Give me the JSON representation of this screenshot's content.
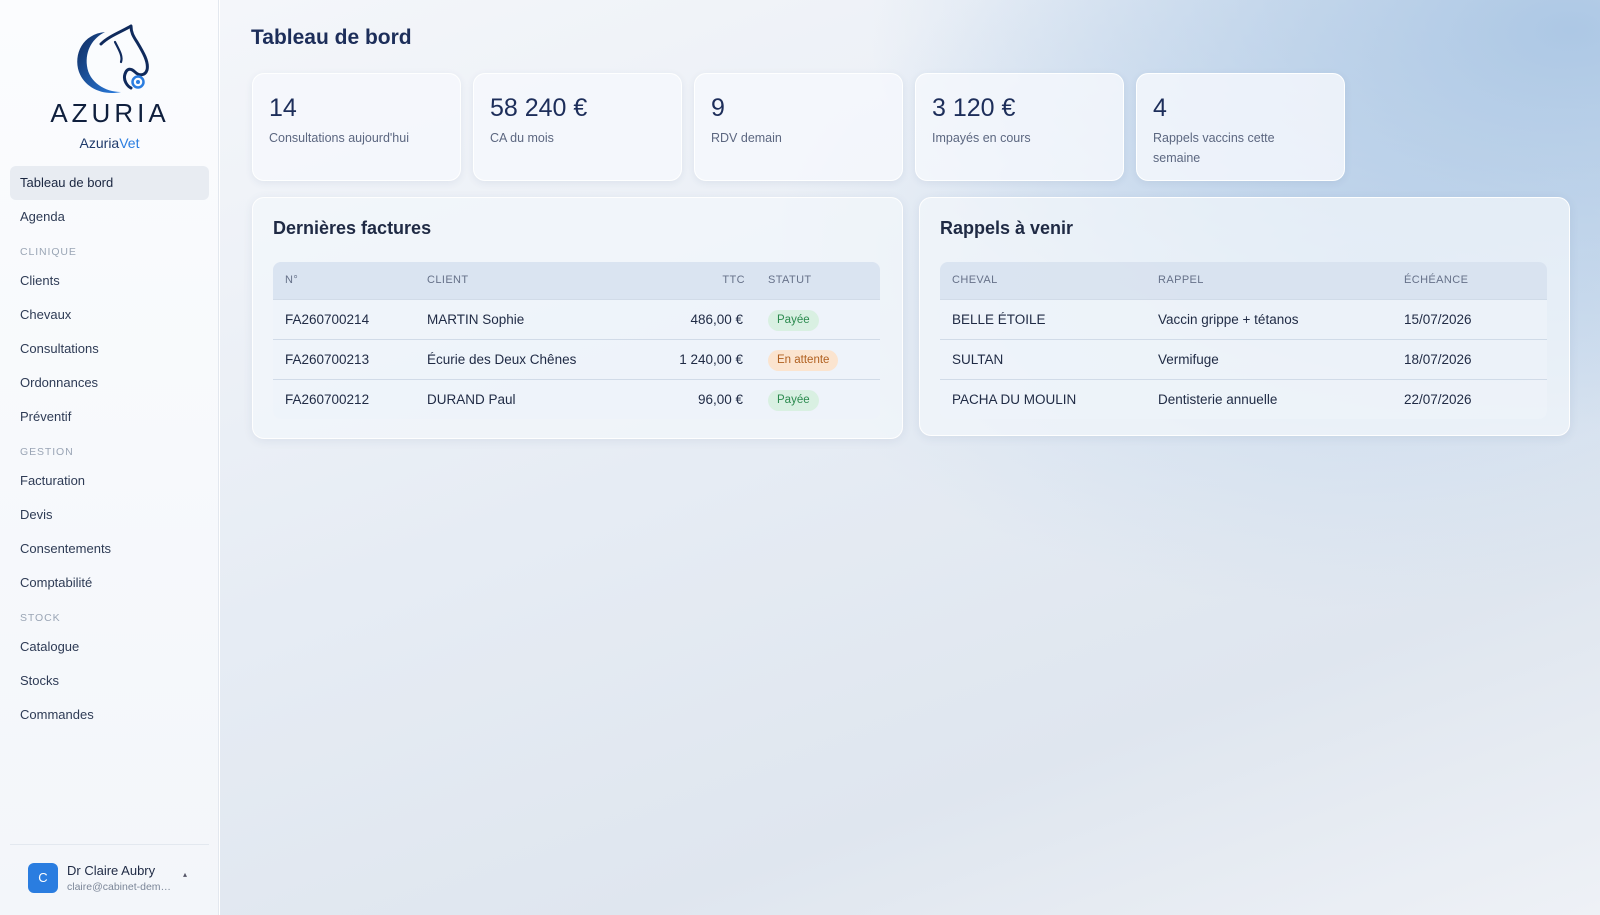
{
  "brand": {
    "logo_text": "AZURIA",
    "name_main": "Azuria",
    "name_accent": "Vet"
  },
  "nav": {
    "dashboard": "Tableau de bord",
    "agenda": "Agenda",
    "section_clinique": "CLINIQUE",
    "clients": "Clients",
    "chevaux": "Chevaux",
    "consultations": "Consultations",
    "ordonnances": "Ordonnances",
    "preventif": "Préventif",
    "section_gestion": "GESTION",
    "facturation": "Facturation",
    "devis": "Devis",
    "consentements": "Consentements",
    "comptabilite": "Comptabilité",
    "section_stock": "STOCK",
    "catalogue": "Catalogue",
    "stocks": "Stocks",
    "commandes": "Commandes"
  },
  "user": {
    "initial": "C",
    "name": "Dr Claire Aubry",
    "email": "claire@cabinet-demo.fr",
    "caret": "▴"
  },
  "page": {
    "title": "Tableau de bord"
  },
  "kpis": [
    {
      "value": "14",
      "label": "Consultations aujourd'hui"
    },
    {
      "value": "58 240 €",
      "label": "CA du mois"
    },
    {
      "value": "9",
      "label": "RDV demain"
    },
    {
      "value": "3 120 €",
      "label": "Impayés en cours"
    },
    {
      "value": "4",
      "label": "Rappels vaccins cette semaine"
    }
  ],
  "invoices": {
    "title": "Dernières factures",
    "headers": {
      "num": "N°",
      "client": "CLIENT",
      "ttc": "TTC",
      "status": "STATUT"
    },
    "rows": [
      {
        "num": "FA260700214",
        "client": "MARTIN Sophie",
        "ttc": "486,00 €",
        "status": "Payée",
        "status_type": "paid"
      },
      {
        "num": "FA260700213",
        "client": "Écurie des Deux Chênes",
        "ttc": "1 240,00 €",
        "status": "En attente",
        "status_type": "pending"
      },
      {
        "num": "FA260700212",
        "client": "DURAND Paul",
        "ttc": "96,00 €",
        "status": "Payée",
        "status_type": "paid"
      }
    ]
  },
  "reminders": {
    "title": "Rappels à venir",
    "headers": {
      "horse": "CHEVAL",
      "reminder": "RAPPEL",
      "due": "ÉCHÉANCE"
    },
    "rows": [
      {
        "horse": "BELLE ÉTOILE",
        "reminder": "Vaccin grippe + tétanos",
        "due": "15/07/2026"
      },
      {
        "horse": "SULTAN",
        "reminder": "Vermifuge",
        "due": "18/07/2026"
      },
      {
        "horse": "PACHA DU MOULIN",
        "reminder": "Dentisterie annuelle",
        "due": "22/07/2026"
      }
    ]
  },
  "colors": {
    "accent": "#2a7de0",
    "navy": "#1d2e5a",
    "paid": "#2b8a4e",
    "pending": "#b06020"
  }
}
